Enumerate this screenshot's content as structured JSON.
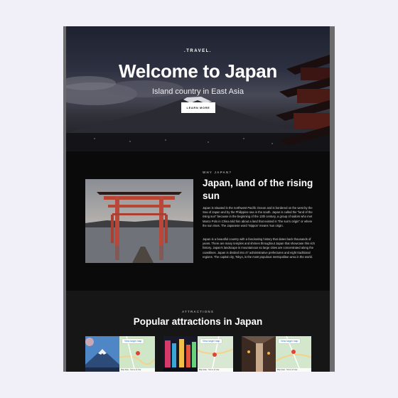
{
  "hero": {
    "brand": ".TRAVEL.",
    "title": "Welcome to Japan",
    "subtitle": "Island country in East Asia",
    "button_label": "LEARN MORE"
  },
  "about": {
    "eyebrow": "WHY JAPAN?",
    "title": "Japan, land of the rising sun",
    "paragraph1": "Japan is situated in the northwest Pacific Ocean and is bordered on the west by the Sea of Japan and by the Philippine sea in the south. Japan is called the \"land of the rising sun\" because in the beginning of the 13th century, a group of sailors who met Marco Polo in China told him about a land that existed in \"the sun's origin\" or where the sun rises. The Japanese word 'Nippon' means 'sun origin.",
    "paragraph2": "Japan is a beautiful country with a fascinating history that dates back thousands of years. There are many temples and shrines throughout Japan that showcase this rich history. Japan's landscape is mountainous so large cities are concentrated along the coastlines. Japan is divided into 47 administrative prefectures and eight traditional regions. The capital city, Tokyo, is the most populous metropolitan area in the world."
  },
  "attractions": {
    "eyebrow": "ATTRACTIONS",
    "title": "Popular attractions in Japan",
    "cards": [
      {
        "map_button": "View larger map",
        "map_footer": "Map data · Terms of Use"
      },
      {
        "map_button": "View larger map",
        "map_footer": "Map data · Terms of Use"
      },
      {
        "map_button": "View larger map",
        "map_footer": "Map data · Terms of Use"
      }
    ]
  }
}
